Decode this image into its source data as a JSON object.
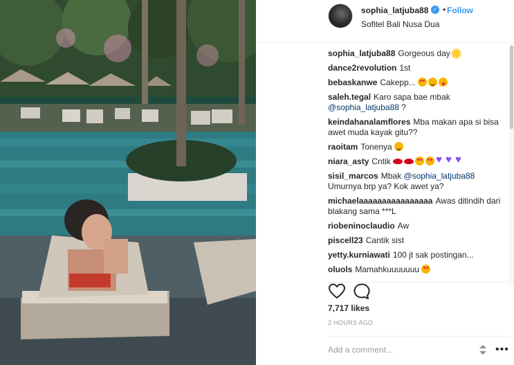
{
  "header": {
    "username": "sophia_latjuba88",
    "dot": "•",
    "follow_label": "Follow",
    "location": "Sofitel Bali Nusa Dua"
  },
  "comments": [
    {
      "user": "sophia_latjuba88",
      "text": "Gorgeous day",
      "emoji": [
        "sun-emoji"
      ]
    },
    {
      "user": "dance2revolution",
      "text": "1st"
    },
    {
      "user": "bebaskanwe",
      "text": "Cakepp...",
      "emoji": [
        "heart-eyes-emoji",
        "grin-emoji",
        "tongue-emoji"
      ]
    },
    {
      "user": "saleh.tegal",
      "text": "Karo sapa bae mbak",
      "mention": "@sophia_latjuba88",
      "suffix": "?"
    },
    {
      "user": "keindahanalamflores",
      "text": "Mba makan apa si bisa awet muda kayak gitu??"
    },
    {
      "user": "raoitam",
      "text": "Tonenya",
      "emoji": [
        "grin-emoji"
      ]
    },
    {
      "user": "niara_asty",
      "text": "Cntik",
      "emoji": [
        "lips-emoji",
        "lips-emoji",
        "heart-eyes-emoji",
        "heart-eyes-emoji",
        "purple-heart-emoji",
        "purple-heart-emoji",
        "purple-heart-emoji"
      ]
    },
    {
      "user": "sisil_marcos",
      "text": "Mbak",
      "mention": "@sophia_latjuba88",
      "suffix": "Umurnya brp ya? Kok awet ya?"
    },
    {
      "user": "michaelaaaaaaaaaaaaaaaa",
      "text": "Awas ditindih dari blakang sama ***L"
    },
    {
      "user": "riobeninoclaudio",
      "text": "Aw"
    },
    {
      "user": "piscell23",
      "text": "Cantik sist"
    },
    {
      "user": "yetty.kurniawati",
      "text": "100 jt sak postingan..."
    },
    {
      "user": "oluols",
      "text": "Mamahkuuuuuuu",
      "emoji": [
        "heart-eyes-emoji"
      ]
    }
  ],
  "actions": {
    "like_icon": "heart-outline-icon",
    "comment_icon": "speech-bubble-icon"
  },
  "likes": "7,717 likes",
  "timestamp": "2 HOURS AGO",
  "add_comment": {
    "placeholder": "Add a comment...",
    "more_label": "•••"
  },
  "colors": {
    "accent": "#3897f0",
    "mention": "#003569",
    "muted": "#999999",
    "text": "#262626"
  }
}
